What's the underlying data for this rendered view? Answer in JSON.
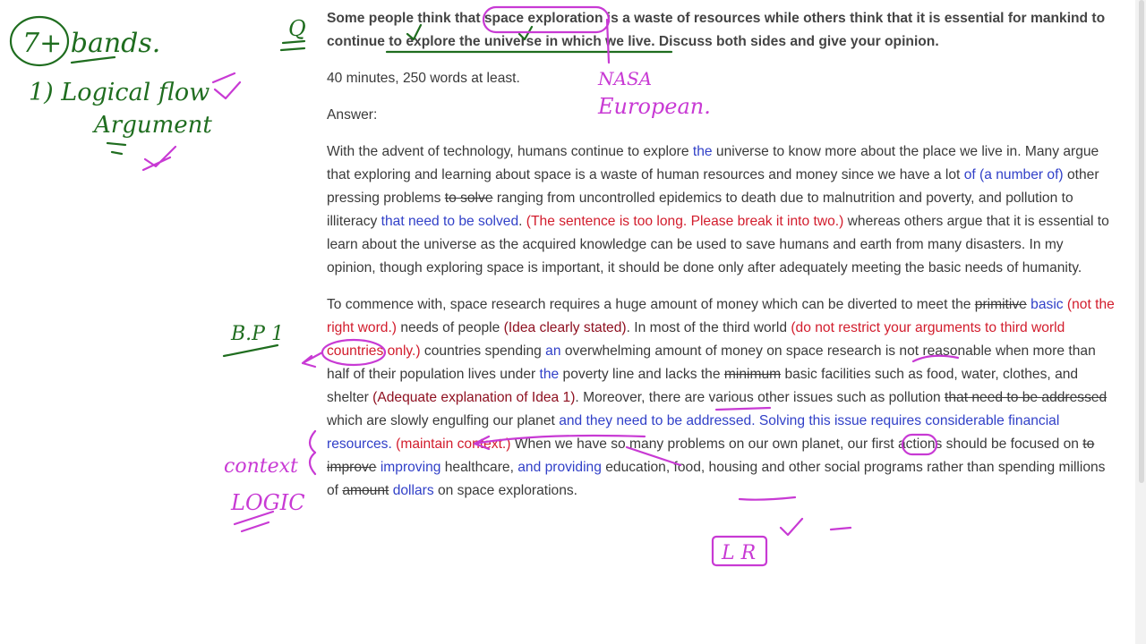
{
  "question": "Some people think that space exploration is a waste of resources while others think that it is essential for mankind to continue to explore the universe in which we live. Discuss both sides and give your opinion.",
  "time_note": "40 minutes, 250 words at least.",
  "answer_label": "Answer:",
  "intro": [
    {
      "t": "With the advent of technology, humans continue to explore ",
      "s": "n"
    },
    {
      "t": "the",
      "s": "b"
    },
    {
      "t": " universe to know more about the place we live in. Many argue that exploring and learning about space is a waste of human resources and money since we have a lot ",
      "s": "n"
    },
    {
      "t": "of (a number of)",
      "s": "b"
    },
    {
      "t": " other pressing problems ",
      "s": "n"
    },
    {
      "t": "to solve",
      "s": "x"
    },
    {
      "t": " ranging from uncontrolled epidemics to death due to malnutrition and poverty, and pollution to illiteracy ",
      "s": "n"
    },
    {
      "t": "that need to be solved",
      "s": "b"
    },
    {
      "t": ". ",
      "s": "n"
    },
    {
      "t": "(The sentence is too long. Please break it into two.)",
      "s": "r"
    },
    {
      "t": " whereas others argue that it is essential to learn about the universe as the acquired knowledge can be used to save humans and earth from many disasters. In my opinion, though exploring space is important, it should be done only after adequately meeting the basic needs of humanity.",
      "s": "n"
    }
  ],
  "body1": [
    {
      "t": "To commence with, space research requires a huge amount of money which can be diverted to meet the ",
      "s": "n"
    },
    {
      "t": "primitive",
      "s": "x"
    },
    {
      "t": " ",
      "s": "n"
    },
    {
      "t": "basic",
      "s": "b"
    },
    {
      "t": " ",
      "s": "n"
    },
    {
      "t": "(not the right word.)",
      "s": "r"
    },
    {
      "t": " needs of people ",
      "s": "n"
    },
    {
      "t": "(Idea clearly stated)",
      "s": "d"
    },
    {
      "t": ". In most of the third world ",
      "s": "n"
    },
    {
      "t": "(do not restrict your arguments to third world countries only.)",
      "s": "r"
    },
    {
      "t": " countries spending ",
      "s": "n"
    },
    {
      "t": "an",
      "s": "b"
    },
    {
      "t": " overwhelming amount of money on space research is not reasonable when more than half of their population lives under ",
      "s": "n"
    },
    {
      "t": "the",
      "s": "b"
    },
    {
      "t": " poverty line and lacks the ",
      "s": "n"
    },
    {
      "t": "minimum",
      "s": "x"
    },
    {
      "t": " basic facilities such as food, water, clothes, and shelter ",
      "s": "n"
    },
    {
      "t": "(Adequate explanation of Idea 1)",
      "s": "d"
    },
    {
      "t": ". Moreover, there are various other issues such as pollution ",
      "s": "n"
    },
    {
      "t": "that need to be addressed",
      "s": "x"
    },
    {
      "t": " which are slowly engulfing our planet ",
      "s": "n"
    },
    {
      "t": "and they need to be addressed. Solving this issue requires considerable financial resources.",
      "s": "b"
    },
    {
      "t": " ",
      "s": "n"
    },
    {
      "t": "(maintain context.)",
      "s": "r"
    },
    {
      "t": " When we have so many problems on our own planet, our first actions should be focused on ",
      "s": "n"
    },
    {
      "t": "to improve",
      "s": "x"
    },
    {
      "t": " ",
      "s": "n"
    },
    {
      "t": "improving",
      "s": "b"
    },
    {
      "t": " healthcare, ",
      "s": "n"
    },
    {
      "t": "and providing",
      "s": "b"
    },
    {
      "t": " education, food, housing and other social programs rather than spending millions of ",
      "s": "n"
    },
    {
      "t": "amount",
      "s": "x"
    },
    {
      "t": " ",
      "s": "n"
    },
    {
      "t": "dollars",
      "s": "b"
    },
    {
      "t": " on space explorations.",
      "s": "n"
    }
  ],
  "annotations": {
    "bands": "7+ bands.",
    "logical_flow": "1) Logical flow",
    "argument": "Argument",
    "q_mark": "Q",
    "nasa": "NASA",
    "european": "European.",
    "bp1": "B.P 1",
    "context": "context",
    "logic": "LOGIC",
    "lr": "L R"
  },
  "colors": {
    "correction_blue": "#3140c8",
    "comment_red": "#d21c2c",
    "praise_dark_red": "#8e1020",
    "ink_green": "#1f6d1f",
    "ink_purple": "#c83ad4"
  }
}
